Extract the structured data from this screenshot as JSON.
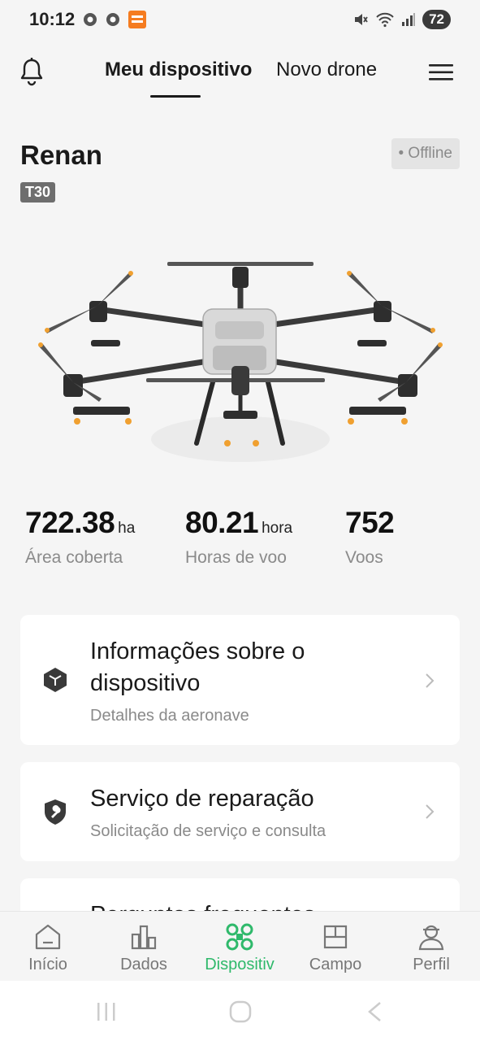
{
  "status_bar": {
    "time": "10:12",
    "battery": "72",
    "icons": [
      "chrome-icon",
      "chrome-icon",
      "temu-icon",
      "mute-icon",
      "wifi-icon",
      "signal-icon"
    ]
  },
  "top_nav": {
    "tabs": [
      {
        "label": "Meu dispositivo",
        "active": true
      },
      {
        "label": "Novo drone",
        "active": false
      }
    ]
  },
  "device": {
    "name": "Renan",
    "model": "T30",
    "status": "• Offline"
  },
  "stats": [
    {
      "value": "722.38",
      "unit": "ha",
      "label": "Área coberta"
    },
    {
      "value": "80.21",
      "unit": "hora",
      "label": "Horas de voo"
    },
    {
      "value": "752",
      "unit": "",
      "label": "Voos"
    }
  ],
  "cards": [
    {
      "title_line1": "Informações sobre o",
      "title_line2": "dispositivo",
      "subtitle": "Detalhes da aeronave",
      "icon": "cube-icon"
    },
    {
      "title": "Serviço de reparação",
      "subtitle": "Solicitação de serviço e consulta",
      "icon": "wrench-shield-icon"
    },
    {
      "title": "Perguntas frequentes"
    }
  ],
  "bottom_nav": [
    {
      "label": "Início",
      "icon": "home-icon",
      "active": false
    },
    {
      "label": "Dados",
      "icon": "bar-chart-icon",
      "active": false
    },
    {
      "label": "Dispositiv",
      "icon": "drone-icon",
      "active": true
    },
    {
      "label": "Campo",
      "icon": "field-icon",
      "active": false
    },
    {
      "label": "Perfil",
      "icon": "profile-icon",
      "active": false
    }
  ],
  "colors": {
    "accent": "#2fb96b",
    "background": "#f5f5f5",
    "card": "#ffffff",
    "muted_text": "#8a8a8a"
  }
}
